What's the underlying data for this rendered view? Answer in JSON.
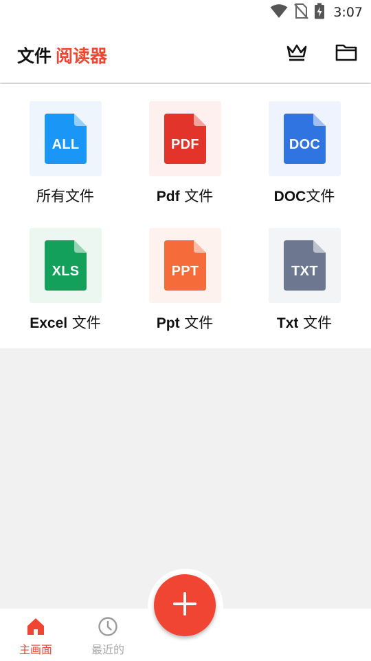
{
  "status_bar": {
    "time": "3:07",
    "icons": [
      "wifi-icon",
      "no-sim-icon",
      "battery-charging-icon"
    ]
  },
  "header": {
    "title_part1": "文件",
    "title_part2": "阅读器",
    "actions": [
      "crown-icon",
      "folder-icon"
    ]
  },
  "file_types": [
    {
      "badge": "ALL",
      "label_en": "",
      "label_zh": "所有文件",
      "color": "#1a96f6",
      "bg": "#eef5fd"
    },
    {
      "badge": "PDF",
      "label_en": "Pdf",
      "label_zh": "文件",
      "color": "#e2342b",
      "bg": "#fdf0ee"
    },
    {
      "badge": "DOC",
      "label_en": "DOC",
      "label_zh": "文件",
      "color": "#2f74e0",
      "bg": "#eef3fd"
    },
    {
      "badge": "XLS",
      "label_en": "Excel",
      "label_zh": "文件",
      "color": "#12a05a",
      "bg": "#ecf7f1"
    },
    {
      "badge": "PPT",
      "label_en": "Ppt",
      "label_zh": "文件",
      "color": "#f56b3a",
      "bg": "#fdf2ee"
    },
    {
      "badge": "TXT",
      "label_en": "Txt",
      "label_zh": "文件",
      "color": "#6d7890",
      "bg": "#f3f4f6"
    }
  ],
  "bottom_nav": {
    "home": {
      "label": "主画面",
      "icon": "home-icon",
      "active": true,
      "color": "#f04532"
    },
    "recent": {
      "label": "最近的",
      "icon": "clock-icon",
      "active": false,
      "color": "#9a9a9a"
    }
  },
  "fab": {
    "icon": "plus-icon",
    "color": "#f04532"
  }
}
